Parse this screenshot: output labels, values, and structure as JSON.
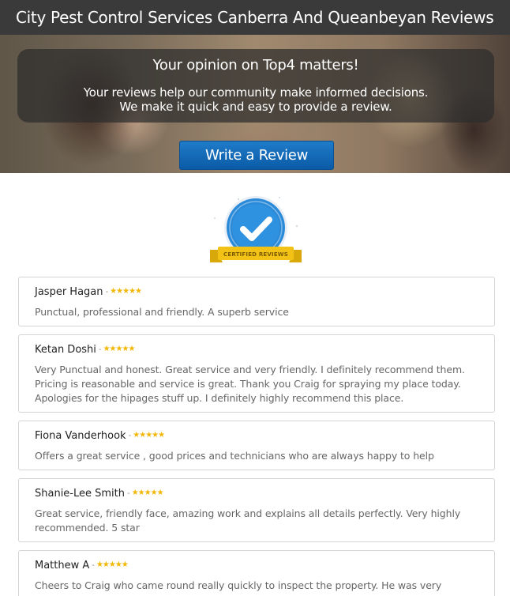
{
  "page": {
    "title": "City Pest Control Services Canberra And Queanbeyan Reviews"
  },
  "hero": {
    "heading": "Your opinion on Top4 matters!",
    "text_line1": "Your reviews help our community make informed decisions.",
    "text_line2": "We make it quick and easy to provide a review.",
    "button_label": "Write a Review"
  },
  "badge": {
    "label": "CERTIFIED REVIEWS"
  },
  "reviews": [
    {
      "name": "Jasper Hagan",
      "rating": 5,
      "text": "Punctual, professional and friendly. A superb service"
    },
    {
      "name": "Ketan Doshi",
      "rating": 5,
      "text": "Very Punctual and honest. Great service and very friendly. I definitely recommend them. Pricing is reasonable and service is great. Thank you Craig for spraying my place today. Apologies for the hipages stuff up. I definitely highly recommend this place."
    },
    {
      "name": "Fiona Vanderhook",
      "rating": 5,
      "text": "Offers a great service , good prices and technicians who are always happy to help"
    },
    {
      "name": "Shanie-Lee Smith",
      "rating": 5,
      "text": "Great service, friendly face, amazing work and explains all details perfectly. Very highly recommended. 5 star"
    },
    {
      "name": "Matthew A",
      "rating": 5,
      "text": "Cheers to Craig who came round really quickly to inspect the property. He was very"
    }
  ],
  "colors": {
    "title_bar": "#3a3a3a",
    "button": "#0b5ba6",
    "star": "#f2b705",
    "badge_blue": "#2a8ad8",
    "badge_ribbon": "#f2c316"
  }
}
